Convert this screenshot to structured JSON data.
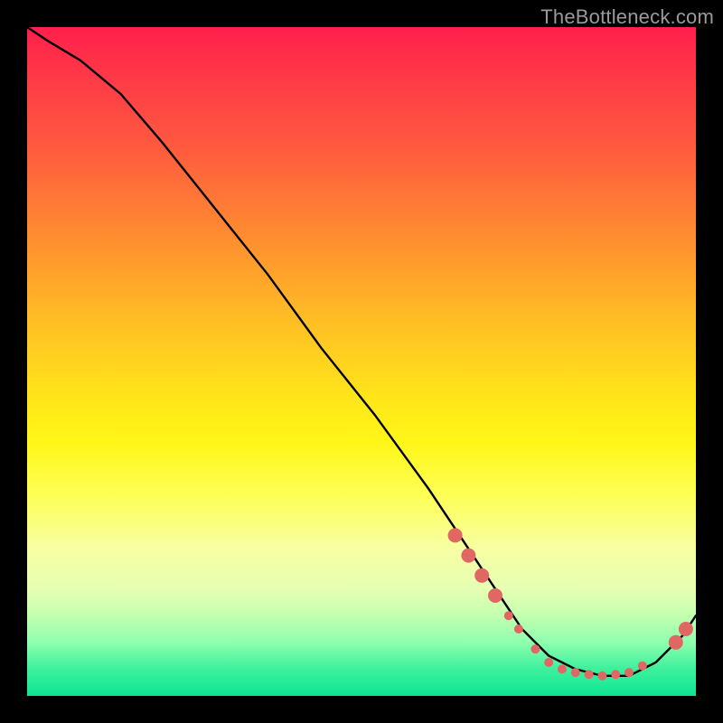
{
  "watermark": "TheBottleneck.com",
  "chart_data": {
    "type": "line",
    "title": "",
    "xlabel": "",
    "ylabel": "",
    "xlim": [
      0,
      100
    ],
    "ylim": [
      0,
      100
    ],
    "grid": false,
    "series": [
      {
        "name": "curve",
        "color": "#000000",
        "x": [
          0,
          3,
          8,
          14,
          20,
          28,
          36,
          44,
          52,
          60,
          66,
          70,
          74,
          78,
          82,
          86,
          90,
          94,
          98,
          100
        ],
        "values": [
          100,
          98,
          95,
          90,
          83,
          73,
          63,
          52,
          42,
          31,
          22,
          16,
          10,
          6,
          4,
          3,
          3,
          5,
          9,
          12
        ]
      }
    ],
    "markers": {
      "color": "#e06763",
      "radius_small": 5,
      "radius_large": 8,
      "points": [
        {
          "x": 64,
          "y": 24,
          "r": "large"
        },
        {
          "x": 66,
          "y": 21,
          "r": "large"
        },
        {
          "x": 68,
          "y": 18,
          "r": "large"
        },
        {
          "x": 70,
          "y": 15,
          "r": "large"
        },
        {
          "x": 72,
          "y": 12,
          "r": "small"
        },
        {
          "x": 73.5,
          "y": 10,
          "r": "small"
        },
        {
          "x": 76,
          "y": 7,
          "r": "small"
        },
        {
          "x": 78,
          "y": 5,
          "r": "small"
        },
        {
          "x": 80,
          "y": 4,
          "r": "small"
        },
        {
          "x": 82,
          "y": 3.5,
          "r": "small"
        },
        {
          "x": 84,
          "y": 3.2,
          "r": "small"
        },
        {
          "x": 86,
          "y": 3,
          "r": "small"
        },
        {
          "x": 88,
          "y": 3.2,
          "r": "small"
        },
        {
          "x": 90,
          "y": 3.5,
          "r": "small"
        },
        {
          "x": 92,
          "y": 4.5,
          "r": "small"
        },
        {
          "x": 97,
          "y": 8,
          "r": "large"
        },
        {
          "x": 98.5,
          "y": 10,
          "r": "large"
        }
      ]
    }
  }
}
